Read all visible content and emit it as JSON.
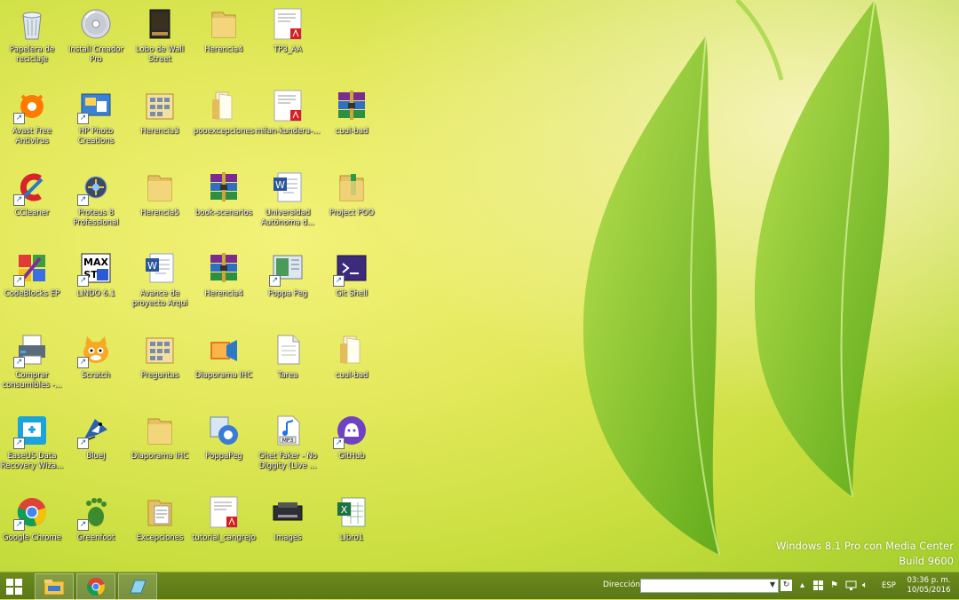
{
  "desktop": {
    "icons": [
      {
        "label": "Papelera de reciclaje",
        "icon": "recycle-bin",
        "shortcut": false
      },
      {
        "label": "Install Creador Pro",
        "icon": "disc",
        "shortcut": false
      },
      {
        "label": "Lobo de Wall Street",
        "icon": "movie-file",
        "shortcut": false
      },
      {
        "label": "Herencia4",
        "icon": "folder",
        "shortcut": false
      },
      {
        "label": "TP3_AA",
        "icon": "pdf",
        "shortcut": false
      },
      {
        "label": "Avast Free Antivirus",
        "icon": "avast",
        "shortcut": true
      },
      {
        "label": "HP Photo Creations",
        "icon": "hp-photo",
        "shortcut": true
      },
      {
        "label": "Herencia3",
        "icon": "grid-folder",
        "shortcut": false
      },
      {
        "label": "pooexcepciones",
        "icon": "folder-open",
        "shortcut": false
      },
      {
        "label": "milan-kundera-...",
        "icon": "pdf",
        "shortcut": false
      },
      {
        "label": "cuul-bad",
        "icon": "rar",
        "shortcut": false
      },
      {
        "label": "CCleaner",
        "icon": "ccleaner",
        "shortcut": true
      },
      {
        "label": "Proteus 8 Professional",
        "icon": "proteus",
        "shortcut": true
      },
      {
        "label": "Herencia5",
        "icon": "folder",
        "shortcut": false
      },
      {
        "label": "book-scenarios",
        "icon": "rar",
        "shortcut": false
      },
      {
        "label": "Universidad Autónoma d...",
        "icon": "word",
        "shortcut": false
      },
      {
        "label": "Project POO",
        "icon": "folder-green",
        "shortcut": false
      },
      {
        "label": "CodeBlocks EP",
        "icon": "codeblocks",
        "shortcut": true
      },
      {
        "label": "LINDO 6.1",
        "icon": "lindo",
        "shortcut": true
      },
      {
        "label": "Avance de proyecto Arqui",
        "icon": "word",
        "shortcut": false
      },
      {
        "label": "Herencia4",
        "icon": "rar",
        "shortcut": false
      },
      {
        "label": "Poppa Peg",
        "icon": "poppa",
        "shortcut": true
      },
      {
        "label": "Git Shell",
        "icon": "shell",
        "shortcut": true
      },
      {
        "label": "Comprar consumibles -...",
        "icon": "printer",
        "shortcut": true
      },
      {
        "label": "Scratch",
        "icon": "scratch",
        "shortcut": true
      },
      {
        "label": "Preguntas",
        "icon": "grid-folder",
        "shortcut": false
      },
      {
        "label": "Diaporama IHC",
        "icon": "movie-maker",
        "shortcut": false
      },
      {
        "label": "Tarea",
        "icon": "text-file",
        "shortcut": false
      },
      {
        "label": "cuul-bad",
        "icon": "folder-open",
        "shortcut": false
      },
      {
        "label": "EaseUS Data Recovery Wiza...",
        "icon": "easeus",
        "shortcut": true
      },
      {
        "label": "BlueJ",
        "icon": "bluej",
        "shortcut": true
      },
      {
        "label": "Diaporama IHC",
        "icon": "folder",
        "shortcut": false
      },
      {
        "label": "PoppaPeg",
        "icon": "poppapeg-app",
        "shortcut": false
      },
      {
        "label": "Ghet Faker - No Diggity (Live ...",
        "icon": "mp3",
        "shortcut": false
      },
      {
        "label": "GitHub",
        "icon": "github",
        "shortcut": true
      },
      {
        "label": "Google Chrome",
        "icon": "chrome",
        "shortcut": true
      },
      {
        "label": "Greenfoot",
        "icon": "greenfoot",
        "shortcut": true
      },
      {
        "label": "Excepciones",
        "icon": "folder-doc",
        "shortcut": false
      },
      {
        "label": "tutorial_cangrejo",
        "icon": "pdf",
        "shortcut": false
      },
      {
        "label": "Images",
        "icon": "printer-dark",
        "shortcut": false
      },
      {
        "label": "Libro1",
        "icon": "excel",
        "shortcut": false
      }
    ]
  },
  "watermark": {
    "edition": "Windows 8.1 Pro con Media Center",
    "build": "Build 9600"
  },
  "taskbar": {
    "pinned": [
      "file-explorer-icon",
      "chrome-icon",
      "app-icon"
    ],
    "address_label": "Dirección",
    "address_value": "",
    "language": "ESP",
    "time": "03:36 p. m.",
    "date": "10/05/2016"
  },
  "colors": {
    "taskbar": "#5f7c18",
    "wallpaper_leaf": "#7cc21c"
  }
}
